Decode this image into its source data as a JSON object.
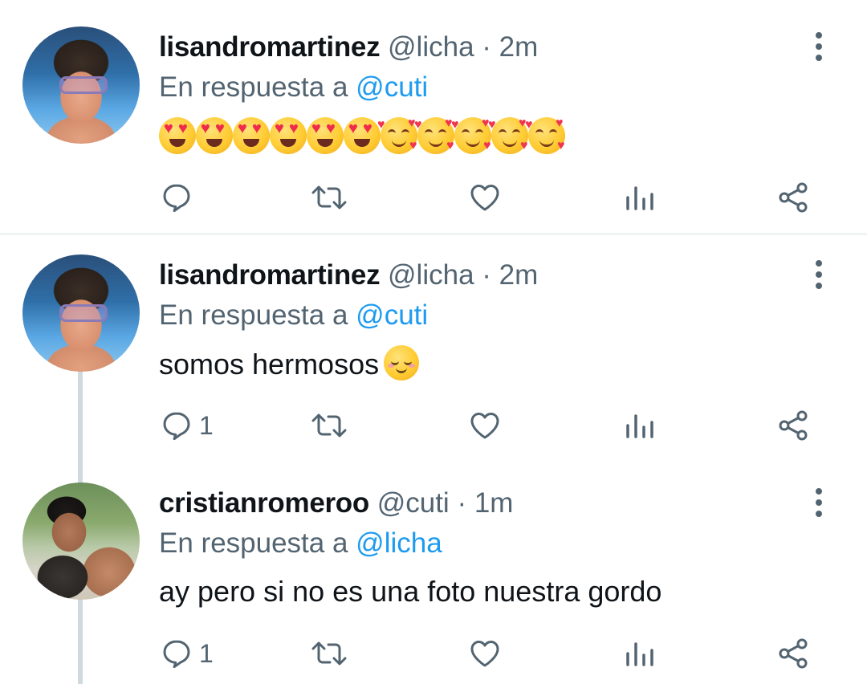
{
  "tweets": [
    {
      "name": "lisandromartinez",
      "handle": "@licha",
      "separator": "·",
      "time": "2m",
      "reply_prefix": "En respuesta a",
      "reply_to": "@cuti",
      "text": "😍😍😍😍😍😍🥰🥰🥰🥰🥰",
      "reply_count": "",
      "avatar": "lisandro-avatar"
    },
    {
      "name": "lisandromartinez",
      "handle": "@licha",
      "separator": "·",
      "time": "2m",
      "reply_prefix": "En respuesta a",
      "reply_to": "@cuti",
      "text": "somos hermosos",
      "text_emoji": "😌",
      "reply_count": "1",
      "avatar": "lisandro-avatar"
    },
    {
      "name": "cristianromeroo",
      "handle": "@cuti",
      "separator": "·",
      "time": "1m",
      "reply_prefix": "En respuesta a",
      "reply_to": "@licha",
      "text": "ay pero si no es una foto nuestra gordo",
      "reply_count": "1",
      "avatar": "cristian-avatar"
    }
  ],
  "icons": [
    "reply-icon",
    "retweet-icon",
    "like-icon",
    "views-icon",
    "share-icon",
    "more-options-icon"
  ],
  "colors": {
    "accent": "#1d9bf0",
    "secondary_text": "#536471",
    "primary_text": "#0f1419",
    "thread_line": "#cfd9de"
  }
}
